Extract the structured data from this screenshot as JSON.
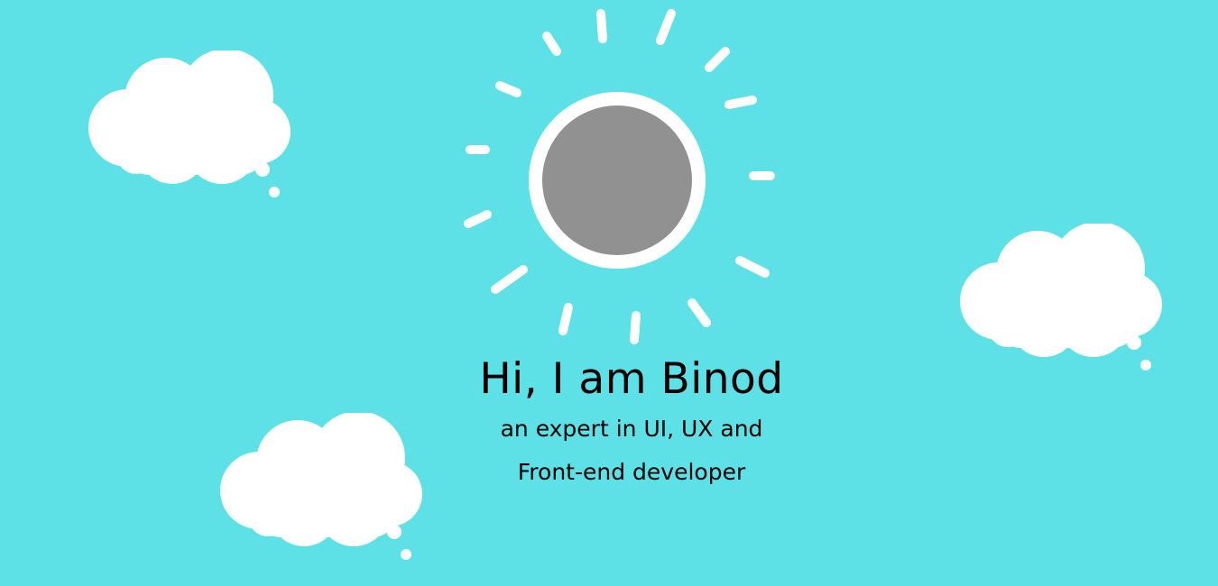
{
  "theme": {
    "sky_color": "#5de1e6",
    "cloud_color": "#ffffff",
    "sun_ring_color": "#ffffff",
    "sun_core_color": "#919191",
    "text_color": "#000000"
  },
  "hero": {
    "title": "Hi, I am Binod",
    "subtitle_line_1": "an expert in UI, UX and",
    "subtitle_line_2": "Front-end developer"
  },
  "illustration": {
    "sun_icon": "sun-icon",
    "cloud_icon": "thought-cloud-icon"
  }
}
